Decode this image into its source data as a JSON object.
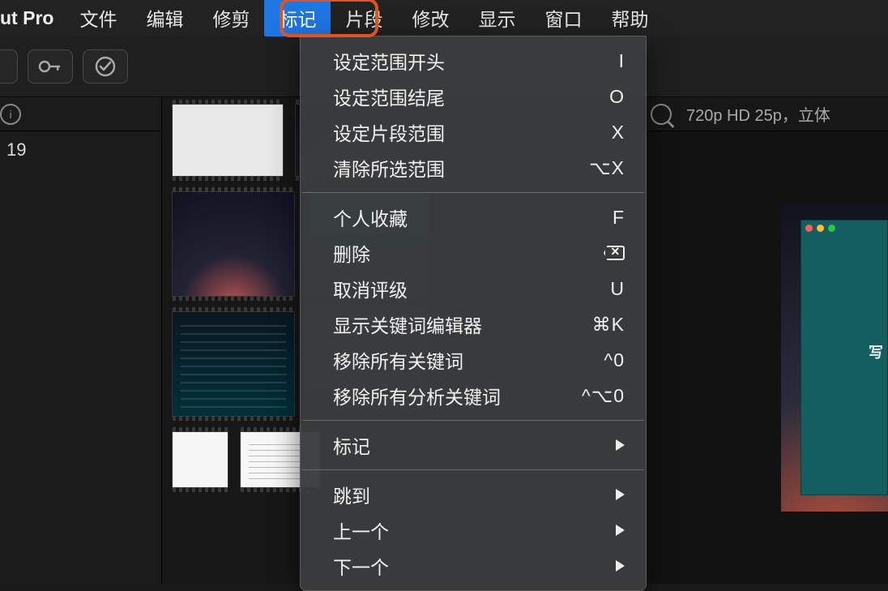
{
  "menubar": {
    "app": "ut Pro",
    "items": [
      "文件",
      "编辑",
      "修剪",
      "标记",
      "片段",
      "修改",
      "显示",
      "窗口",
      "帮助"
    ],
    "active_index": 3
  },
  "sidebar": {
    "item0": "19"
  },
  "right_header": {
    "format_info": "720p HD 25p，立体"
  },
  "dropdown": {
    "groups": [
      [
        {
          "label": "设定范围开头",
          "shortcut": "I"
        },
        {
          "label": "设定范围结尾",
          "shortcut": "O"
        },
        {
          "label": "设定片段范围",
          "shortcut": "X"
        },
        {
          "label": "清除所选范围",
          "shortcut": "⌥X"
        }
      ],
      [
        {
          "label": "个人收藏",
          "shortcut": "F"
        },
        {
          "label": "删除",
          "shortcut": "[del]"
        },
        {
          "label": "取消评级",
          "shortcut": "U"
        },
        {
          "label": "显示关键词编辑器",
          "shortcut": "⌘K"
        },
        {
          "label": "移除所有关键词",
          "shortcut": "^0"
        },
        {
          "label": "移除所有分析关键词",
          "shortcut": "^⌥0"
        }
      ],
      [
        {
          "label": "标记",
          "submenu": true
        }
      ],
      [
        {
          "label": "跳到",
          "submenu": true
        },
        {
          "label": "上一个",
          "submenu": true
        },
        {
          "label": "下一个",
          "submenu": true
        }
      ]
    ]
  },
  "preview": {
    "overlay_text": "写"
  }
}
